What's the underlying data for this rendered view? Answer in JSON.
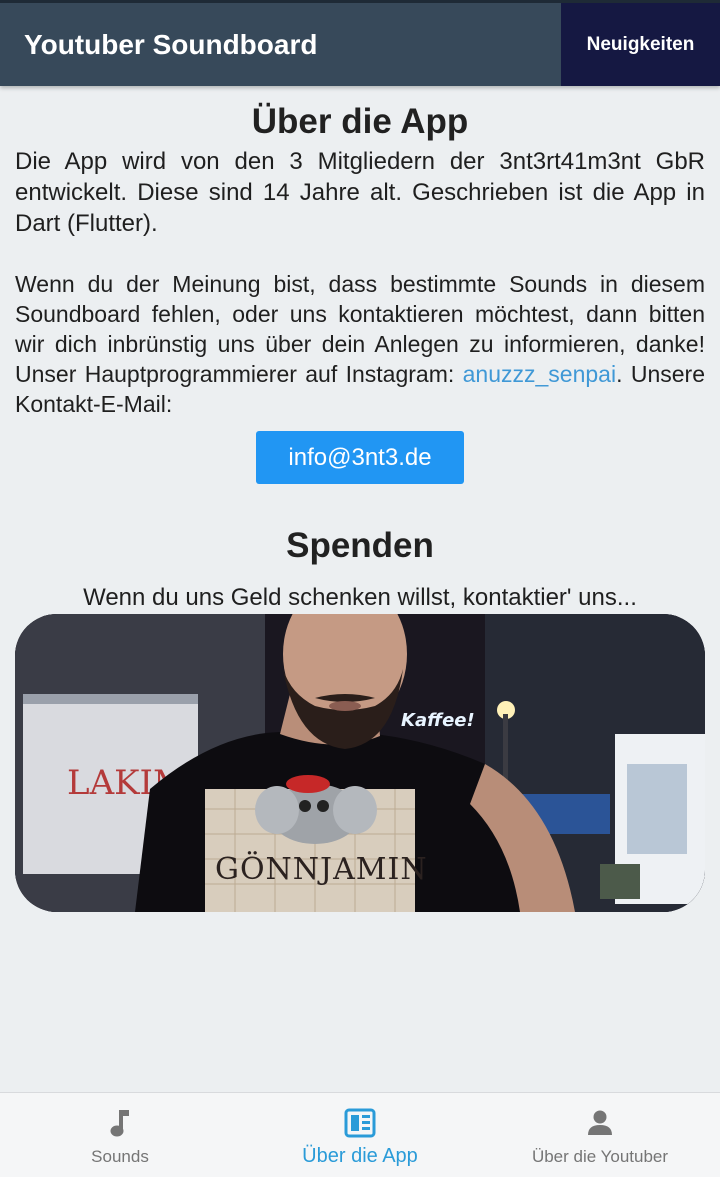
{
  "appbar": {
    "title": "Youtuber Soundboard",
    "news_label": "Neuigkeiten"
  },
  "about": {
    "heading": "Über die App",
    "paragraph1": "Die App wird von den 3 Mitgliedern der 3nt3rt41m3nt GbR entwickelt. Diese sind 14 Jahre alt. Geschrieben ist die App in Dart (Flutter).",
    "paragraph2_before": "Wenn du der Meinung bist, dass bestimmte Sounds in diesem Soundboard fehlen, oder uns kontaktieren möchtest, dann bitten wir dich inbrünstig uns über dein Anlegen zu informieren, danke! Unser Hauptprogrammierer auf Instagram: ",
    "instagram_link": "anuzzz_senpai",
    "paragraph2_after": ". Unsere Kontakt-E-Mail:",
    "email": "info@3nt3.de"
  },
  "donate": {
    "heading": "Spenden",
    "text": "Wenn du uns Geld schenken willst, kontaktier' uns...",
    "photo_shirt_text": "GÖNNJAMIN",
    "photo_sign_left": "LAKIMI",
    "photo_sign_right": "Kaffee!"
  },
  "bottom_nav": {
    "items": [
      {
        "label": "Sounds",
        "icon": "music-note-icon"
      },
      {
        "label": "Über die App",
        "icon": "app-info-icon"
      },
      {
        "label": "Über die Youtuber",
        "icon": "person-icon"
      }
    ],
    "active_index": 1
  },
  "colors": {
    "appbar": "#37495a",
    "news_button": "#151842",
    "accent": "#2196f3",
    "link": "#3f98d6",
    "nav_active": "#2a9bd8"
  }
}
